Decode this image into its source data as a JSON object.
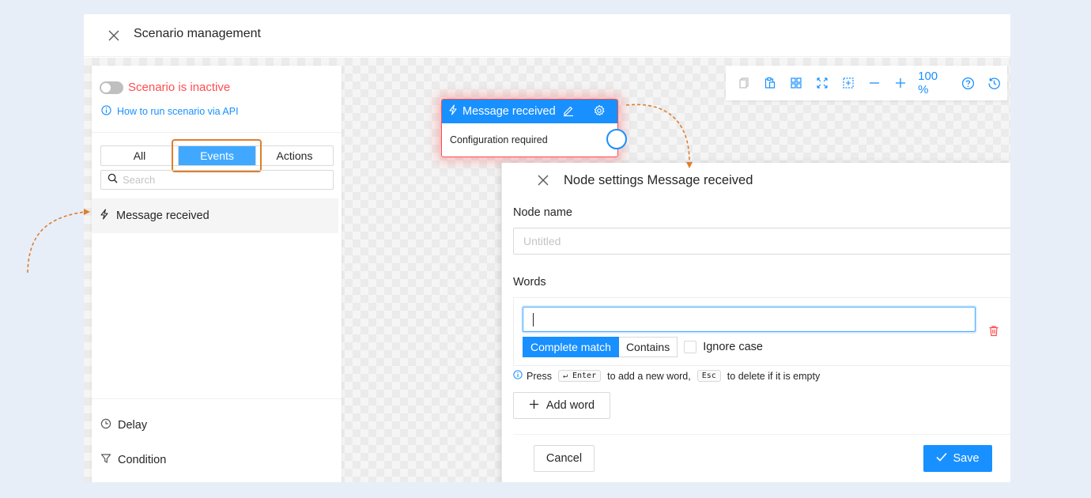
{
  "window": {
    "title": "Scenario management"
  },
  "sidebar": {
    "status_label": "Scenario is inactive",
    "api_link": "How to run scenario via API",
    "tabs": [
      {
        "label": "All"
      },
      {
        "label": "Events"
      },
      {
        "label": "Actions"
      }
    ],
    "search_placeholder": "Search",
    "event_item": "Message received",
    "bottom_items": [
      {
        "label": "Delay",
        "icon": "clock-icon"
      },
      {
        "label": "Condition",
        "icon": "filter-icon"
      }
    ]
  },
  "toolbar": {
    "zoom": "100 %",
    "icons": [
      "copy-icon",
      "paste-icon",
      "grid-icon",
      "fit-icon",
      "select-area-icon",
      "zoom-out-icon",
      "zoom-in-icon",
      "help-icon",
      "history-icon"
    ]
  },
  "node": {
    "title": "Message received",
    "body": "Configuration required"
  },
  "panel": {
    "title": "Node settings Message received",
    "node_name_label": "Node name",
    "node_name_placeholder": "Untitled",
    "words_label": "Words",
    "match_complete": "Complete match",
    "match_contains": "Contains",
    "ignore_case": "Ignore case",
    "hint_press": "Press",
    "hint_enter_key": "↵ Enter",
    "hint_mid": "to add a new word,",
    "hint_esc_key": "Esc",
    "hint_end": "to delete if it is empty",
    "add_word": "Add word",
    "cancel": "Cancel",
    "save": "Save"
  },
  "colors": {
    "primary": "#1890ff",
    "danger": "#ff4d4f",
    "annotation": "#e07d2c"
  }
}
